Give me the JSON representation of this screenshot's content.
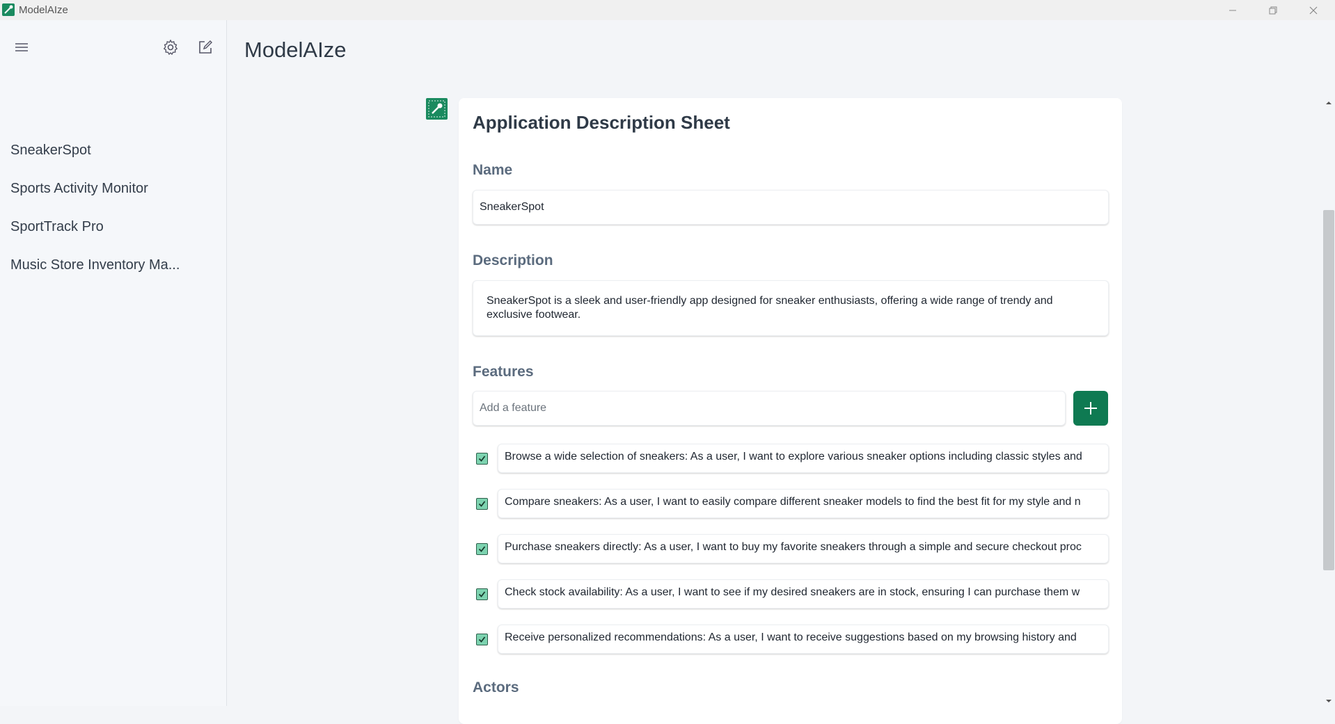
{
  "window": {
    "title": "ModelAIze"
  },
  "sidebar": {
    "items": [
      {
        "label": "SneakerSpot"
      },
      {
        "label": "Sports Activity Monitor"
      },
      {
        "label": "SportTrack Pro"
      },
      {
        "label": "Music Store Inventory Ma..."
      }
    ]
  },
  "main": {
    "title": "ModelAIze"
  },
  "sheet": {
    "title": "Application Description Sheet",
    "name_label": "Name",
    "name_value": "SneakerSpot",
    "description_label": "Description",
    "description_value": "SneakerSpot is a sleek and user-friendly app designed for sneaker enthusiasts, offering a wide range of trendy and exclusive footwear.",
    "features_label": "Features",
    "feature_placeholder": "Add a feature",
    "features": [
      {
        "checked": true,
        "text": "Browse a wide selection of sneakers: As a user, I want to explore various sneaker options including classic styles and"
      },
      {
        "checked": true,
        "text": "Compare sneakers: As a user, I want to easily compare different sneaker models to find the best fit for my style and n"
      },
      {
        "checked": true,
        "text": "Purchase sneakers directly: As a user, I want to buy my favorite sneakers through a simple and secure checkout proc"
      },
      {
        "checked": true,
        "text": "Check stock availability: As a user, I want to see if my desired sneakers are in stock, ensuring I can purchase them w"
      },
      {
        "checked": true,
        "text": "Receive personalized recommendations: As a user, I want to receive suggestions based on my browsing history and"
      }
    ],
    "actors_label": "Actors"
  },
  "colors": {
    "accent": "#0f7a52",
    "checkbox": "#7dd3b0"
  },
  "icons": [
    "menu-icon",
    "gear-icon",
    "new-chat-icon",
    "plus-icon",
    "check-icon"
  ]
}
